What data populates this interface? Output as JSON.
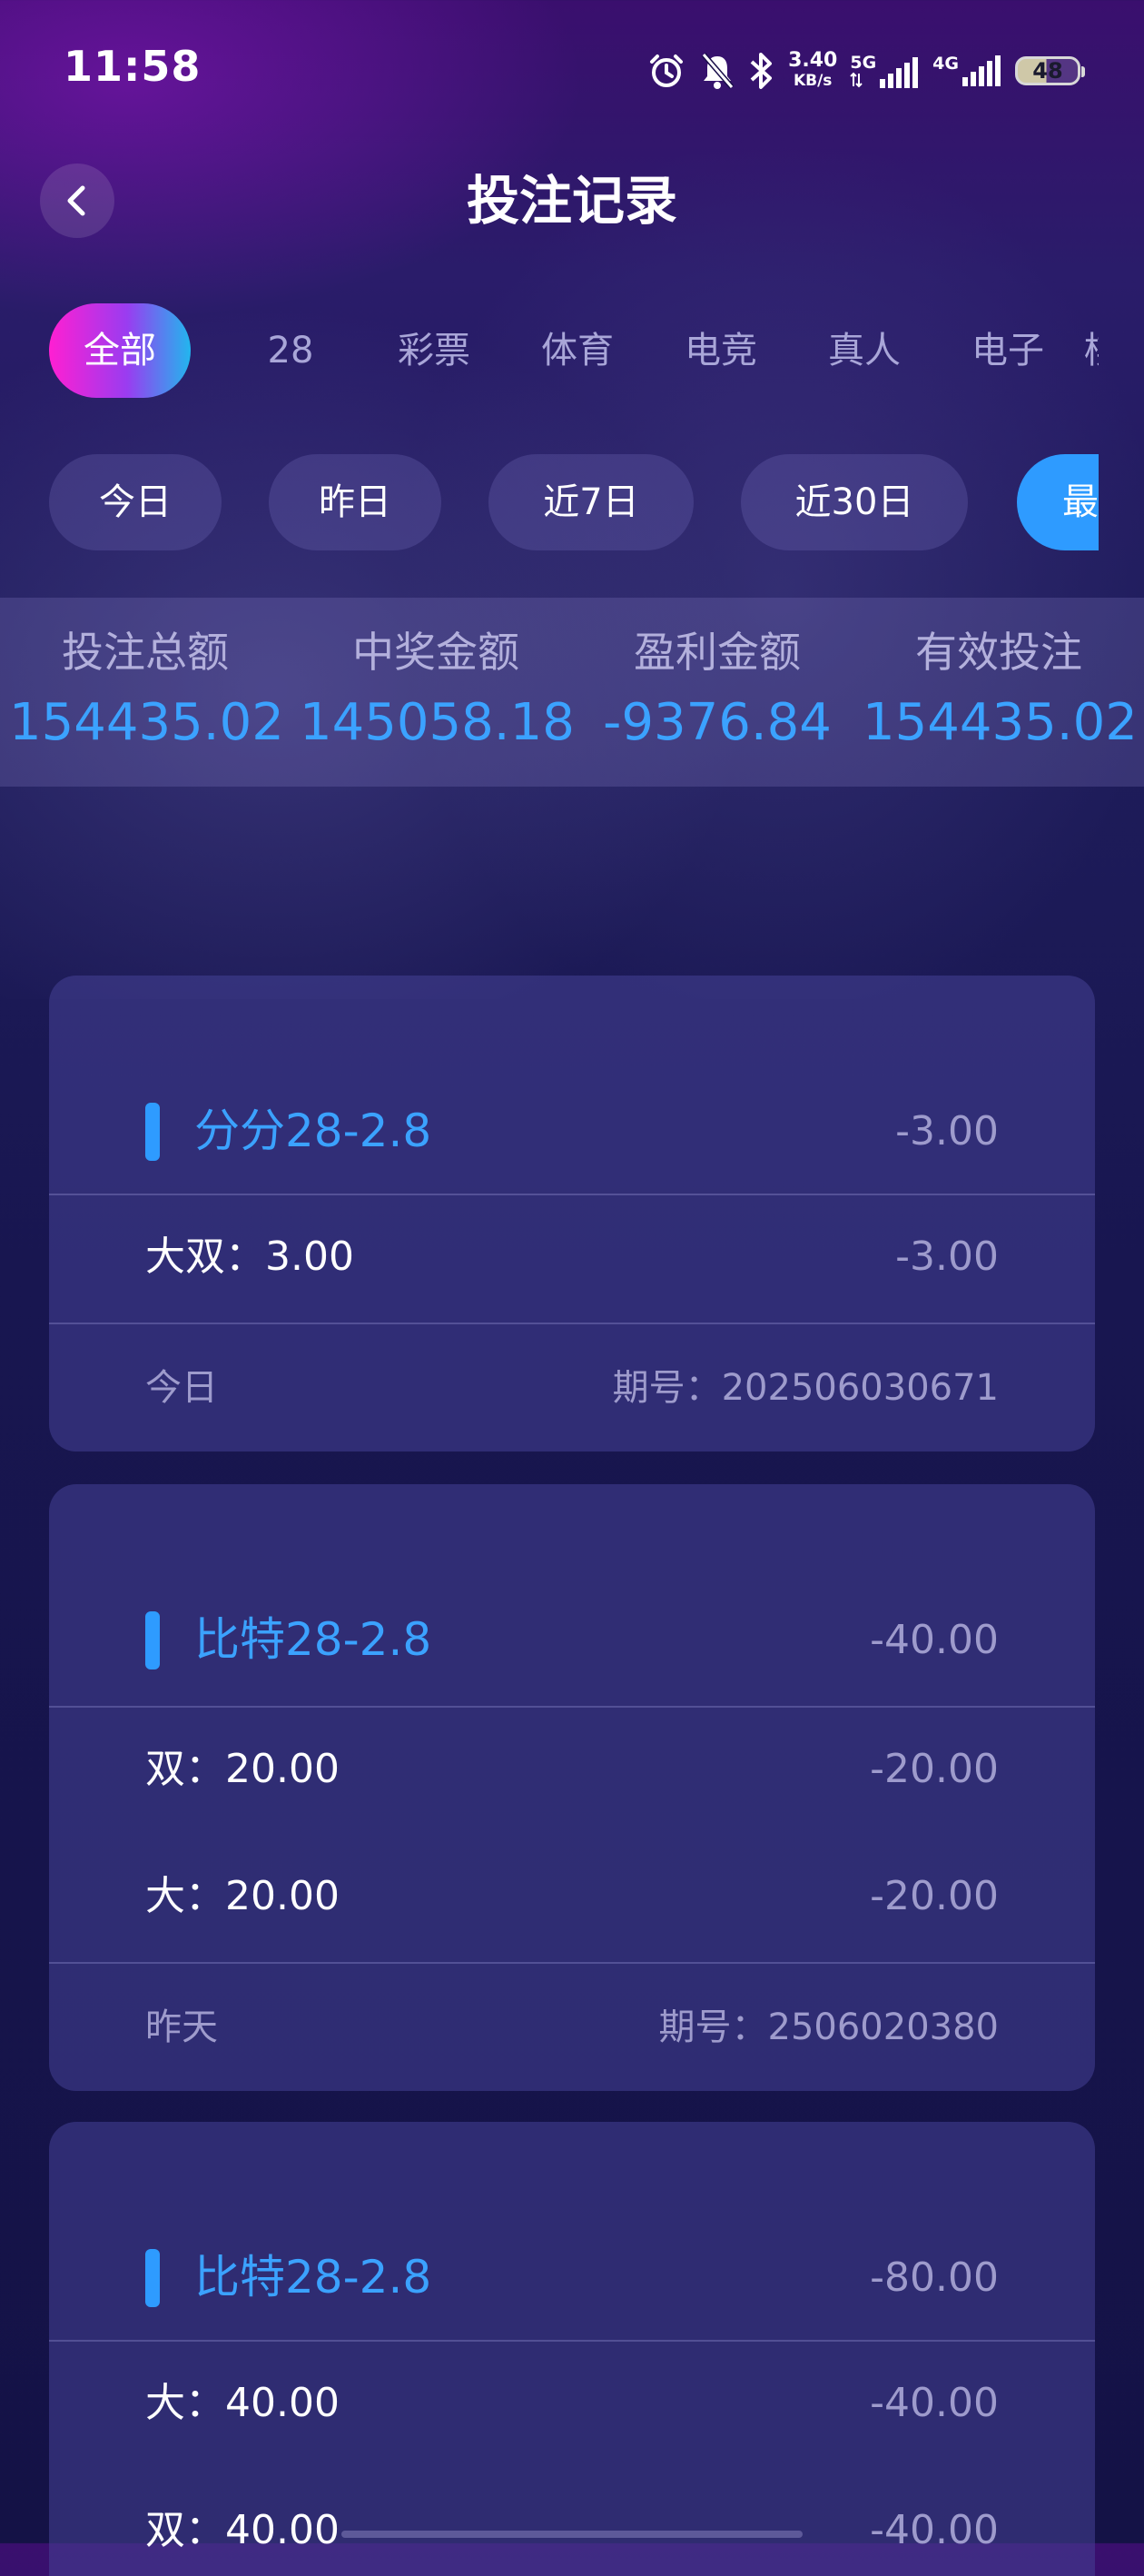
{
  "status_bar": {
    "time": "11:58",
    "net_speed": "3.40",
    "net_speed_unit": "KB/s",
    "signal1_label": "5G",
    "signal2_label": "4G",
    "battery": "48"
  },
  "header": {
    "title": "投注记录"
  },
  "category_tabs": [
    {
      "label": "全部",
      "active": true
    },
    {
      "label": "28",
      "active": false
    },
    {
      "label": "彩票",
      "active": false
    },
    {
      "label": "体育",
      "active": false
    },
    {
      "label": "电竞",
      "active": false
    },
    {
      "label": "真人",
      "active": false
    },
    {
      "label": "电子",
      "active": false
    },
    {
      "label": "棋",
      "active": false
    }
  ],
  "date_filters": [
    {
      "label": "今日",
      "active": false
    },
    {
      "label": "昨日",
      "active": false
    },
    {
      "label": "近7日",
      "active": false
    },
    {
      "label": "近30日",
      "active": false
    },
    {
      "label": "最",
      "active": true
    }
  ],
  "summary": [
    {
      "label": "投注总额",
      "value": "154435.02"
    },
    {
      "label": "中奖金额",
      "value": "145058.18"
    },
    {
      "label": "盈利金额",
      "value": "-9376.84"
    },
    {
      "label": "有效投注",
      "value": "154435.02"
    }
  ],
  "records": [
    {
      "game": "分分28-2.8",
      "total": "-3.00",
      "bets": [
        {
          "name": "大双：3.00",
          "amount": "-3.00"
        }
      ],
      "date": "今日",
      "issue": "期号：202506030671"
    },
    {
      "game": "比特28-2.8",
      "total": "-40.00",
      "bets": [
        {
          "name": "双：20.00",
          "amount": "-20.00"
        },
        {
          "name": "大：20.00",
          "amount": "-20.00"
        }
      ],
      "date": "昨天",
      "issue": "期号：2506020380"
    },
    {
      "game": "比特28-2.8",
      "total": "-80.00",
      "bets": [
        {
          "name": "大：40.00",
          "amount": "-40.00"
        },
        {
          "name": "双：40.00",
          "amount": "-40.00"
        }
      ],
      "date": "",
      "issue": ""
    }
  ],
  "colors": {
    "accent_blue": "#3ba2ff",
    "active_tab_gradient_start": "#ff1fd2",
    "active_tab_gradient_end": "#22b6ee"
  }
}
